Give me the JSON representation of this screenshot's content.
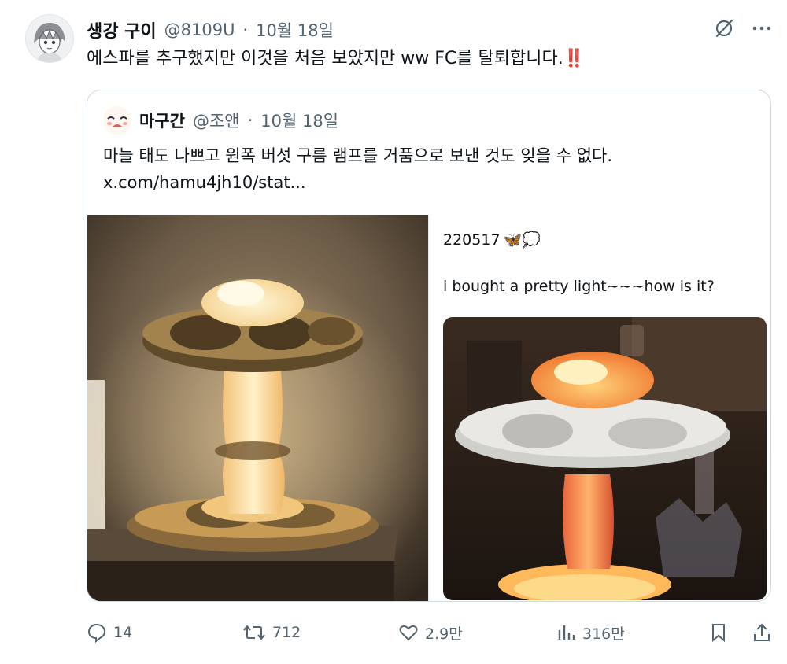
{
  "tweet": {
    "author_name": "생강 구이",
    "author_handle": "@8109U",
    "separator": "·",
    "date": "10월 18일",
    "text": "에스파를 추구했지만 이것을 처음 보았지만 ww FC를 탈퇴합니다.",
    "emoji": "‼️"
  },
  "top_icons": [
    "grok-icon",
    "more-icon"
  ],
  "quoted": {
    "author_name": "마구간",
    "author_handle": "@조앤",
    "separator": "·",
    "date": "10월 18일",
    "text": "마늘 태도 나쁘고 원폭 버섯 구름 램프를 거품으로 보낸 것도 잊을 수 없다.",
    "link": "x.com/hamu4jh10/stat..."
  },
  "screenshot_panel": {
    "id_text": "220517",
    "id_emoji": "🦋💭",
    "text": "i bought a pretty light~~~how is it?"
  },
  "actions": {
    "replies": "14",
    "retweets": "712",
    "likes": "2.9만",
    "views": "316만"
  },
  "colors": {
    "accent_red": "#d4213d",
    "muted": "#536471",
    "border": "#cfd9de"
  }
}
